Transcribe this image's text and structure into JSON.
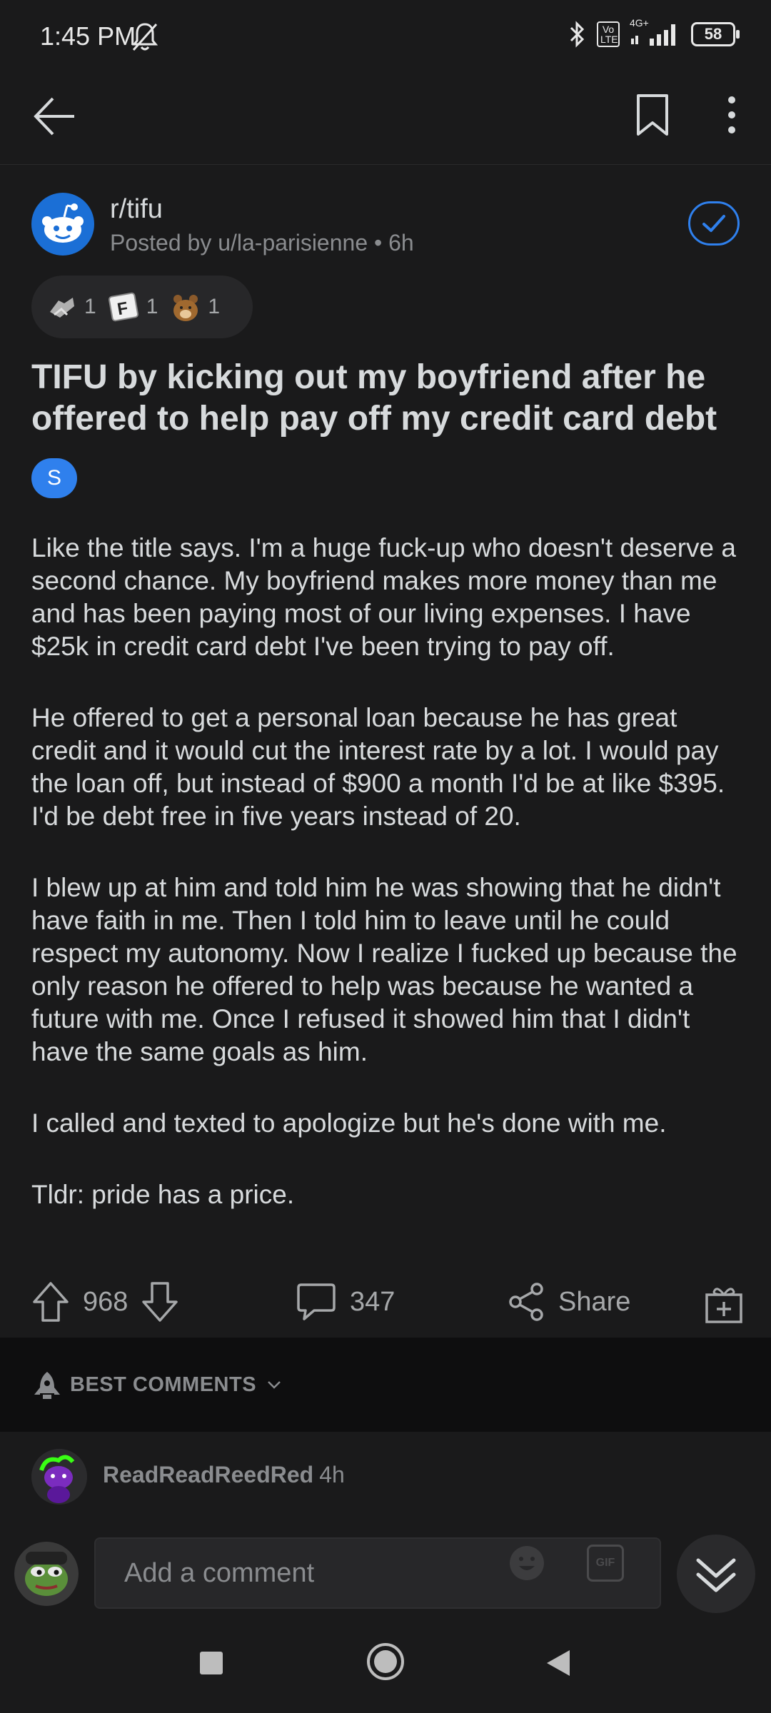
{
  "status_bar": {
    "time": "1:45 PM",
    "network_badge": "Vo\nLTE",
    "network_type": "4G+",
    "battery": "58"
  },
  "post": {
    "subreddit": "r/tifu",
    "posted_by": "Posted by u/la-parisienne • 6h",
    "awards": [
      {
        "icon": "helpful-award-icon",
        "count": "1"
      },
      {
        "icon": "f-award-icon",
        "count": "1"
      },
      {
        "icon": "bear-award-icon",
        "count": "1"
      }
    ],
    "title": "TIFU by kicking out my boyfriend after he offered to help pay off my credit card debt",
    "flair": "S",
    "body": [
      "Like the title says. I'm a huge fuck-up who doesn't deserve a second chance. My boyfriend makes more money than me and has been paying most of our living expenses. I have $25k in credit card debt I've been trying to pay off.",
      "He offered to get a personal loan because he has great credit and it would cut the interest rate by a lot. I would pay the loan off, but instead of $900 a month I'd be at like $395. I'd be debt free in five years instead of 20.",
      "I blew up at him and told him he was showing that he didn't have faith in me. Then I told him to leave until he could respect my autonomy. Now I realize I fucked up because the only reason he offered to help was because he wanted a future with me. Once I refused it showed him that I didn't have the same goals as him.",
      "I called and texted to apologize but he's done with me.",
      "Tldr: pride has a price."
    ],
    "upvotes": "968",
    "comments": "347",
    "share_label": "Share"
  },
  "comments_section": {
    "sort_label": "BEST COMMENTS",
    "first_comment": {
      "user": "ReadReadReedRed",
      "time": "4h"
    }
  },
  "composer": {
    "placeholder": "Add a comment",
    "gif_label": "GIF"
  },
  "colors": {
    "background": "#1a1a1b",
    "accent": "#2f80ed",
    "text": "#d7dadc",
    "muted": "#8a8c8f"
  }
}
